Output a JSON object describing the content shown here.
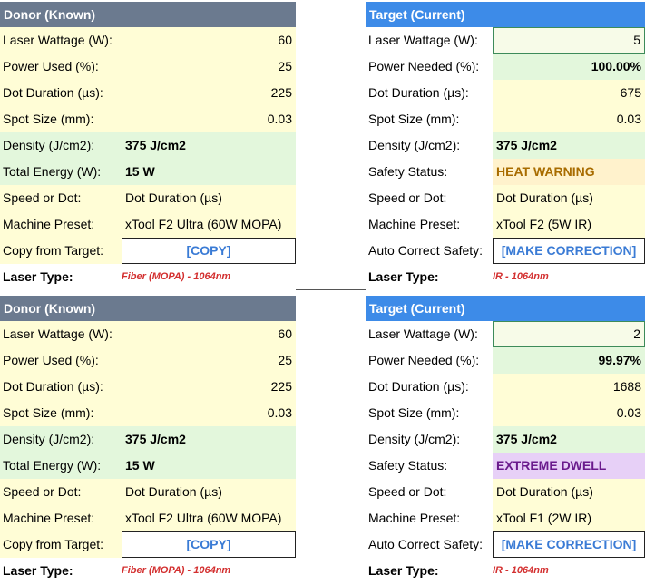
{
  "sections": [
    {
      "donor": {
        "header": "Donor (Known)",
        "labels": {
          "wattage": "Laser Wattage (W):",
          "power": "Power Used (%):",
          "dot": "Dot Duration (µs):",
          "spot": "Spot Size (mm):",
          "density": "Density (J/cm2):",
          "energy": "Total Energy (W):",
          "speed": "Speed or Dot:",
          "preset": "Machine Preset:",
          "copy": "Copy from Target:",
          "type": "Laser Type:"
        },
        "values": {
          "wattage": "60",
          "power": "25",
          "dot": "225",
          "spot": "0.03",
          "density": "375 J/cm2",
          "energy": "15 W",
          "speed": "Dot Duration (µs)",
          "preset": "xTool F2 Ultra (60W MOPA)",
          "copy": "[COPY]",
          "type": "Fiber (MOPA) - 1064nm"
        }
      },
      "target": {
        "header": "Target (Current)",
        "labels": {
          "wattage": "Laser Wattage (W):",
          "power": "Power Needed (%):",
          "dot": "Dot Duration (µs):",
          "spot": "Spot Size (mm):",
          "density": "Density (J/cm2):",
          "safety": "Safety Status:",
          "speed": "Speed or Dot:",
          "preset": "Machine Preset:",
          "auto": "Auto Correct Safety:",
          "type": "Laser Type:"
        },
        "values": {
          "wattage": "5",
          "power": "100.00%",
          "dot": "675",
          "spot": "0.03",
          "density": "375 J/cm2",
          "safety": "HEAT WARNING",
          "speed": "Dot Duration (µs)",
          "preset": "xTool F2 (5W IR)",
          "auto": "[MAKE CORRECTION]",
          "type": "IR - 1064nm"
        },
        "safety_style": "warn"
      }
    },
    {
      "donor": {
        "header": "Donor (Known)",
        "labels": {
          "wattage": "Laser Wattage (W):",
          "power": "Power Used (%):",
          "dot": "Dot Duration (µs):",
          "spot": "Spot Size (mm):",
          "density": "Density (J/cm2):",
          "energy": "Total Energy (W):",
          "speed": "Speed or Dot:",
          "preset": "Machine Preset:",
          "copy": "Copy from Target:",
          "type": "Laser Type:"
        },
        "values": {
          "wattage": "60",
          "power": "25",
          "dot": "225",
          "spot": "0.03",
          "density": "375 J/cm2",
          "energy": "15 W",
          "speed": "Dot Duration (µs)",
          "preset": "xTool F2 Ultra (60W MOPA)",
          "copy": "[COPY]",
          "type": "Fiber (MOPA) - 1064nm"
        }
      },
      "target": {
        "header": "Target (Current)",
        "labels": {
          "wattage": "Laser Wattage (W):",
          "power": "Power Needed (%):",
          "dot": "Dot Duration (µs):",
          "spot": "Spot Size (mm):",
          "density": "Density (J/cm2):",
          "safety": "Safety Status:",
          "speed": "Speed or Dot:",
          "preset": "Machine Preset:",
          "auto": "Auto Correct Safety:",
          "type": "Laser Type:"
        },
        "values": {
          "wattage": "2",
          "power": "99.97%",
          "dot": "1688",
          "spot": "0.03",
          "density": "375 J/cm2",
          "safety": "EXTREME DWELL",
          "speed": "Dot Duration (µs)",
          "preset": "xTool F1 (2W IR)",
          "auto": "[MAKE CORRECTION]",
          "type": "IR - 1064nm"
        },
        "safety_style": "extreme"
      }
    }
  ],
  "colors": {
    "donor_header": "#6b7a8f",
    "target_header": "#3d8be8",
    "cream": "#fffdd6",
    "green": "#e3f7dc",
    "warning": "#fff2cc",
    "extreme": "#e7d0f7",
    "button_text": "#3a7bd5",
    "laser_type": "#d32f2f"
  }
}
